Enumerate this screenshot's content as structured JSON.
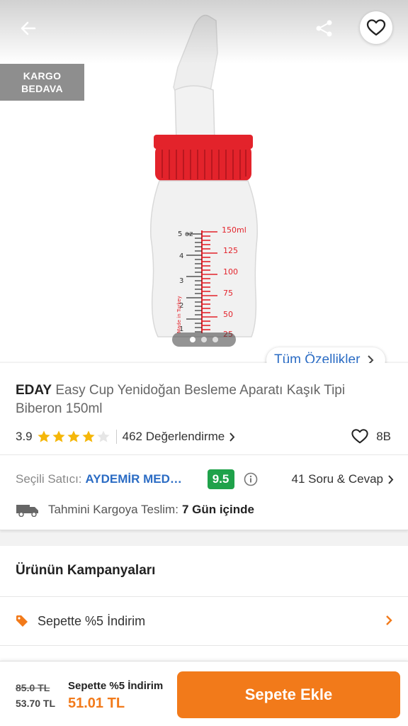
{
  "hero": {
    "kargo_badge_line1": "KARGO",
    "kargo_badge_line2": "BEDAVA",
    "image_page": 1,
    "image_count": 3,
    "all_features_label": "Tüm Özellikler"
  },
  "product": {
    "brand": "EDAY",
    "name": "Easy Cup Yenidoğan Besleme Aparatı Kaşık Tipi Biberon 150ml",
    "rating": "3.9",
    "rating_value": 3.9,
    "stars_max": 5,
    "reviews_label": "462 Değerlendirme",
    "favorites": "8B",
    "bottle_markings": {
      "oz": [
        "5",
        "oz",
        "4",
        "3",
        "2",
        "1"
      ],
      "ml": [
        "150ml",
        "125",
        "100",
        "75",
        "50",
        "25"
      ],
      "made_in": "Made in Turkey"
    }
  },
  "seller": {
    "label": "Seçili Satıcı:",
    "name": "AYDEMİR MEDİKAL",
    "score": "9.5",
    "qa_label": "41 Soru & Cevap"
  },
  "delivery": {
    "label": "Tahmini Kargoya Teslim:",
    "value": "7 Gün içinde"
  },
  "campaigns": {
    "title": "Ürünün Kampanyaları",
    "items": [
      {
        "label": "Sepette %5 İndirim"
      }
    ]
  },
  "bottom_bar": {
    "old_price": "85.0 TL",
    "current_price": "53.70 TL",
    "campaign_label": "Sepette %5 İndirim",
    "discount_price": "51.01 TL",
    "add_to_cart": "Sepete Ekle"
  },
  "colors": {
    "accent": "#f27a1a",
    "link": "#2b6cc4",
    "score_green": "#1fa24a",
    "star": "#f5b70a"
  }
}
